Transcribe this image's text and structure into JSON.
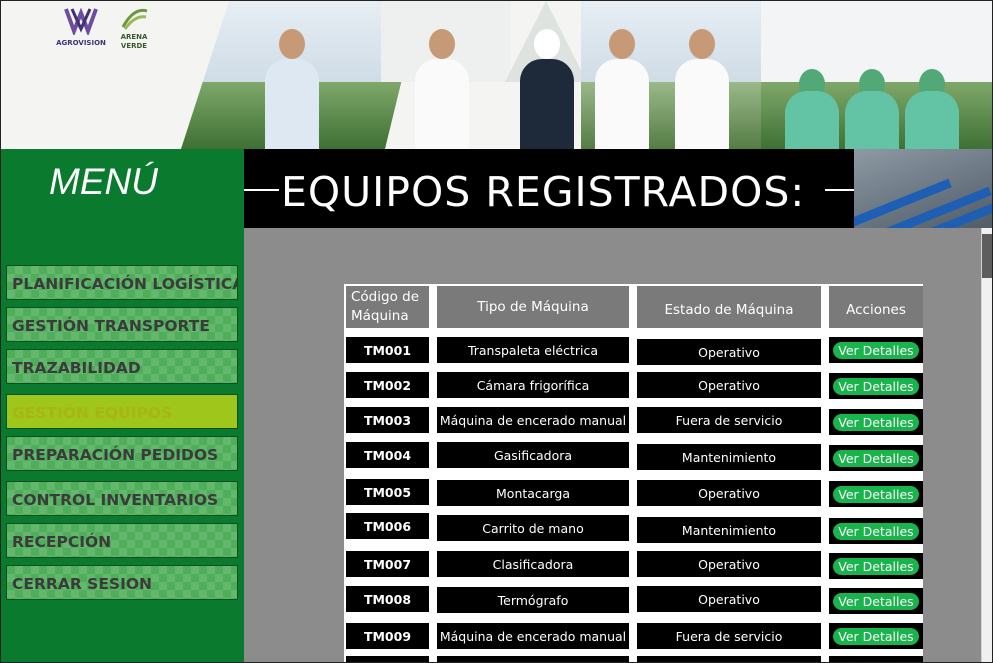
{
  "banner": {
    "logos": [
      "AGROVISION",
      "ARENA VERDE"
    ]
  },
  "menu": {
    "title": "MENÚ",
    "items": [
      {
        "label": "PLANIFICACIÓN LOGÍSTICA",
        "active": false
      },
      {
        "label": "GESTIÓN TRANSPORTE",
        "active": false
      },
      {
        "label": "TRAZABILIDAD",
        "active": false
      },
      {
        "label": "GESTIÓN EQUIPOS",
        "active": true
      },
      {
        "label": "PREPARACIÓN PEDIDOS",
        "active": false
      },
      {
        "label": "CONTROL INVENTARIOS",
        "active": false
      },
      {
        "label": "RECEPCIÓN",
        "active": false
      },
      {
        "label": "CERRAR SESION",
        "active": false
      }
    ]
  },
  "page": {
    "title": "EQUIPOS REGISTRADOS:"
  },
  "table": {
    "headers": [
      "Código de Máquina",
      "Tipo de Máquina",
      "Estado de Máquina",
      "Acciones"
    ],
    "rows": [
      {
        "code": "TM001",
        "type": "Transpaleta eléctrica",
        "status": "Operativo",
        "action": "Ver Detalles"
      },
      {
        "code": "TM002",
        "type": "Cámara frigorífica",
        "status": "Operativo",
        "action": "Ver Detalles"
      },
      {
        "code": "TM003",
        "type": "Máquina de encerado manual",
        "status": "Fuera de servicio",
        "action": "Ver Detalles"
      },
      {
        "code": "TM004",
        "type": "Gasificadora",
        "status": "Mantenimiento",
        "action": "Ver Detalles"
      },
      {
        "code": "TM005",
        "type": "Montacarga",
        "status": "Operativo",
        "action": "Ver Detalles"
      },
      {
        "code": "TM006",
        "type": "Carrito de mano",
        "status": "Mantenimiento",
        "action": "Ver Detalles"
      },
      {
        "code": "TM007",
        "type": "Clasificadora",
        "status": "Operativo",
        "action": "Ver Detalles"
      },
      {
        "code": "TM008",
        "type": "Termógrafo",
        "status": "Operativo",
        "action": "Ver Detalles"
      },
      {
        "code": "TM009",
        "type": "Máquina de encerado manual",
        "status": "Fuera de servicio",
        "action": "Ver Detalles"
      }
    ]
  },
  "colors": {
    "menu_bg": "#0a7a2f",
    "active_item": "#9ec61b",
    "button": "#19b44c",
    "header_bg": "#000000",
    "table_header": "#7a7a7a"
  }
}
